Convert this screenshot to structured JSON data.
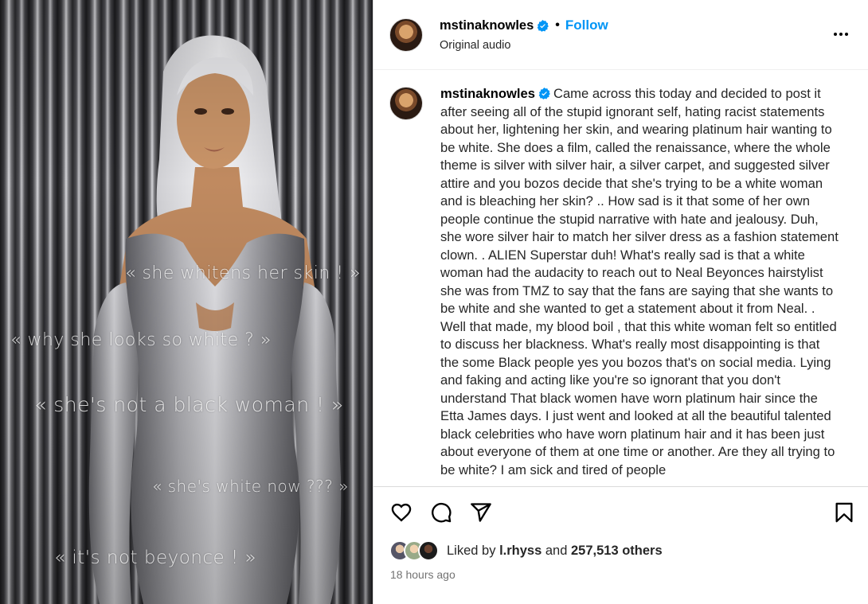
{
  "post": {
    "username": "mstinaknowles",
    "verified": true,
    "follow_label": "Follow",
    "separator": "•",
    "audio": "Original audio",
    "overlay_texts": [
      "« she whitens her skin ! »",
      "« why she looks so white ? »",
      "« she's not a black woman ! »",
      "« she's white now ??? »",
      "« it's not beyonce ! »"
    ],
    "caption": "Came across this today and decided to post it after seeing all of the stupid ignorant self, hating racist statements about her, lightening her skin, and wearing platinum hair wanting to be white. She does a film, called the renaissance, where the whole theme is silver with silver hair, a silver carpet, and suggested silver attire and you bozos decide that she's trying to be a white woman and is bleaching her skin? .. How sad is it that some of her own people continue the stupid narrative with hate and jealousy. Duh, she wore silver hair to match her silver dress as a fashion statement clown. . ALIEN Superstar duh! What's really sad is that a white woman had the audacity to reach out to Neal Beyonces hairstylist she was from TMZ to say that the fans are saying that she wants to be white and she wanted to get a statement about it from Neal. . Well that made, my blood boil , that this white woman felt so entitled to discuss her blackness. What's really most disappointing is that the some Black people yes you bozos that's on social media. Lying and faking and acting like you're so ignorant that you don't understand That black women have worn platinum hair since the Etta James days. I just went and looked at all the beautiful talented black celebrities who have worn platinum hair and it has been just about everyone of them at one time or another. Are they all trying to be white? I am sick and tired of people",
    "likes": {
      "prefix": "Liked by",
      "user": "l.rhyss",
      "joiner": "and",
      "count": "257,513 others"
    },
    "timestamp": "18 hours ago"
  },
  "icons": {
    "verified": "verified-badge-icon",
    "more": "more-options-icon",
    "like": "heart-icon",
    "comment": "comment-icon",
    "share": "share-icon",
    "save": "bookmark-icon"
  },
  "colors": {
    "accent": "#0095f6",
    "text": "#262626",
    "muted": "#737373"
  }
}
